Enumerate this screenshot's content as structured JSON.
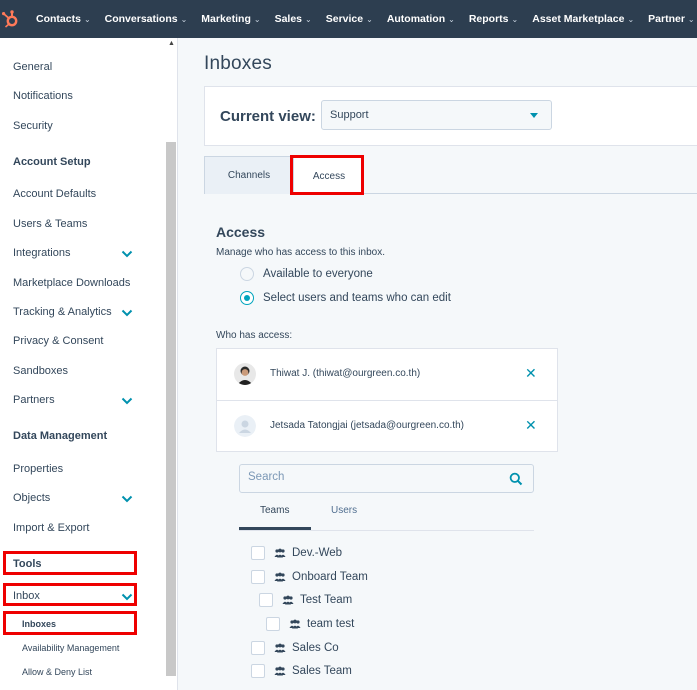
{
  "topnav": {
    "items": [
      {
        "label": "Contacts"
      },
      {
        "label": "Conversations"
      },
      {
        "label": "Marketing"
      },
      {
        "label": "Sales"
      },
      {
        "label": "Service"
      },
      {
        "label": "Automation"
      },
      {
        "label": "Reports"
      },
      {
        "label": "Asset Marketplace"
      },
      {
        "label": "Partner"
      }
    ],
    "brand_color": "#ff7a59",
    "bg_color": "#2d3e50"
  },
  "sidebar": {
    "general": "General",
    "notifications": "Notifications",
    "security": "Security",
    "account_setup_heading": "Account Setup",
    "account_defaults": "Account Defaults",
    "users_teams": "Users & Teams",
    "integrations": "Integrations",
    "marketplace_downloads": "Marketplace Downloads",
    "tracking_analytics": "Tracking & Analytics",
    "privacy_consent": "Privacy & Consent",
    "sandboxes": "Sandboxes",
    "partners": "Partners",
    "data_management_heading": "Data Management",
    "properties": "Properties",
    "objects": "Objects",
    "import_export": "Import & Export",
    "tools_heading": "Tools",
    "inbox": "Inbox",
    "inboxes": "Inboxes",
    "availability_management": "Availability Management",
    "allow_deny_list": "Allow & Deny List"
  },
  "main": {
    "title": "Inboxes",
    "current_view_label": "Current view:",
    "current_view_value": "Support",
    "tabs": [
      {
        "label": "Channels"
      },
      {
        "label": "Access"
      }
    ],
    "access": {
      "title": "Access",
      "description": "Manage who has access to this inbox.",
      "options": [
        {
          "label": "Available to everyone",
          "selected": false
        },
        {
          "label": "Select users and teams who can edit",
          "selected": true
        }
      ],
      "who_label": "Who has access:",
      "users": [
        {
          "name": "Thiwat J. (thiwat@ourgreen.co.th)"
        },
        {
          "name": "Jetsada Tatongjai (jetsada@ourgreen.co.th)"
        }
      ],
      "remove_glyph": "✕",
      "search_placeholder": "Search",
      "subtabs": [
        {
          "label": "Teams"
        },
        {
          "label": "Users"
        }
      ],
      "teams": [
        {
          "name": "Dev.-Web",
          "checked": false
        },
        {
          "name": "Onboard Team",
          "checked": false
        },
        {
          "name": "Test Team",
          "checked": false
        },
        {
          "name": "team test",
          "checked": false
        },
        {
          "name": "Sales Co",
          "checked": false
        },
        {
          "name": "Sales Team",
          "checked": false
        }
      ]
    }
  },
  "accent_color": "#00a4bd",
  "highlight_color": "#e00000"
}
